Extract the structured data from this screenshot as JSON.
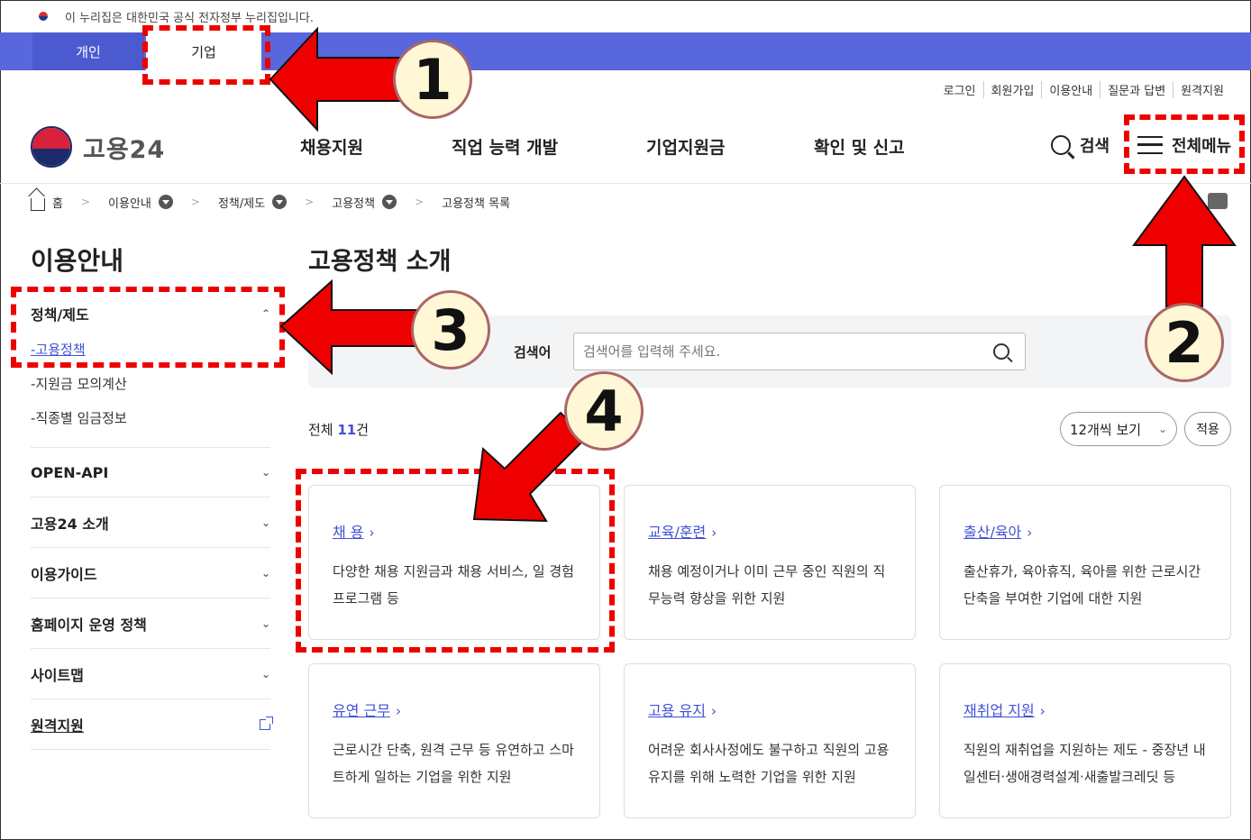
{
  "gov_banner": {
    "text": "이 누리집은 대한민국 공식 전자정부 누리집입니다."
  },
  "top_tabs": {
    "personal": "개인",
    "company": "기업"
  },
  "util_links": [
    "로그인",
    "회원가입",
    "이용안내",
    "질문과 답변",
    "원격지원"
  ],
  "header": {
    "logo": "고용24",
    "nav": [
      "채용지원",
      "직업 능력 개발",
      "기업지원금",
      "확인 및 신고"
    ],
    "search_label": "검색",
    "menu_label": "전체메뉴"
  },
  "breadcrumb": [
    "홈",
    "이용안내",
    "정책/제도",
    "고용정책",
    "고용정책 목록"
  ],
  "sidebar": {
    "title": "이용안내",
    "group_label": "정책/제도",
    "sub_items": [
      "-고용정책",
      "-지원금 모의계산",
      "-직종별 임금정보"
    ],
    "items": [
      "OPEN-API",
      "고용24 소개",
      "이용가이드",
      "홈페이지 운영 정책",
      "사이트맵",
      "원격지원"
    ]
  },
  "main": {
    "title": "고용정책 소개",
    "search_label": "검색어",
    "search_placeholder": "검색어를 입력해 주세요.",
    "count_prefix": "전체 ",
    "count_value": "11",
    "count_suffix": "건",
    "per_page": "12개씩 보기",
    "apply": "적용"
  },
  "cards": [
    {
      "title": "채 용",
      "desc": "다양한 채용 지원금과 채용 서비스, 일 경험 프로그램 등"
    },
    {
      "title": "교육/훈련",
      "desc": "채용 예정이거나 이미 근무 중인 직원의 직무능력 향상을 위한 지원"
    },
    {
      "title": "출산/육아",
      "desc": "출산휴가, 육아휴직, 육아를 위한 근로시간 단축을 부여한 기업에 대한 지원"
    },
    {
      "title": "유연 근무",
      "desc": "근로시간 단축, 원격 근무 등 유연하고 스마트하게 일하는 기업을 위한 지원"
    },
    {
      "title": "고용 유지",
      "desc": "어려운 회사사정에도 불구하고 직원의 고용유지를 위해 노력한 기업을 위한 지원"
    },
    {
      "title": "재취업 지원",
      "desc": "직원의 재취업을 지원하는 제도 - 중장년 내일센터·생애경력설계·새출발크레딧 등"
    }
  ],
  "annotations": [
    "1",
    "2",
    "3",
    "4"
  ],
  "colors": {
    "top_bar": "#5867dd",
    "link": "#4052d6",
    "annotation": "#e00000"
  }
}
